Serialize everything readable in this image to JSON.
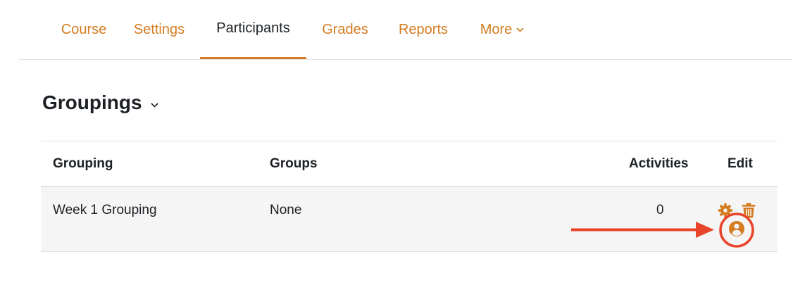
{
  "nav": {
    "tabs": [
      {
        "label": "Course"
      },
      {
        "label": "Settings"
      },
      {
        "label": "Participants",
        "active": true
      },
      {
        "label": "Grades"
      },
      {
        "label": "Reports"
      },
      {
        "label": "More"
      }
    ]
  },
  "page": {
    "title": "Groupings"
  },
  "table": {
    "headers": {
      "grouping": "Grouping",
      "groups": "Groups",
      "activities": "Activities",
      "edit": "Edit"
    },
    "rows": [
      {
        "grouping": "Week 1 Grouping",
        "groups": "None",
        "activities": "0",
        "edit_icons": [
          "gear-icon",
          "trash-icon",
          "user-circle-icon"
        ]
      }
    ]
  },
  "annotation": {
    "arrow_color": "#e8432b",
    "highlight": "user-circle-icon"
  },
  "colors": {
    "accent": "#d47c21",
    "text": "#1d2125",
    "row_bg": "#f5f5f5",
    "border": "#dee2e6",
    "annotation": "#e8432b"
  }
}
